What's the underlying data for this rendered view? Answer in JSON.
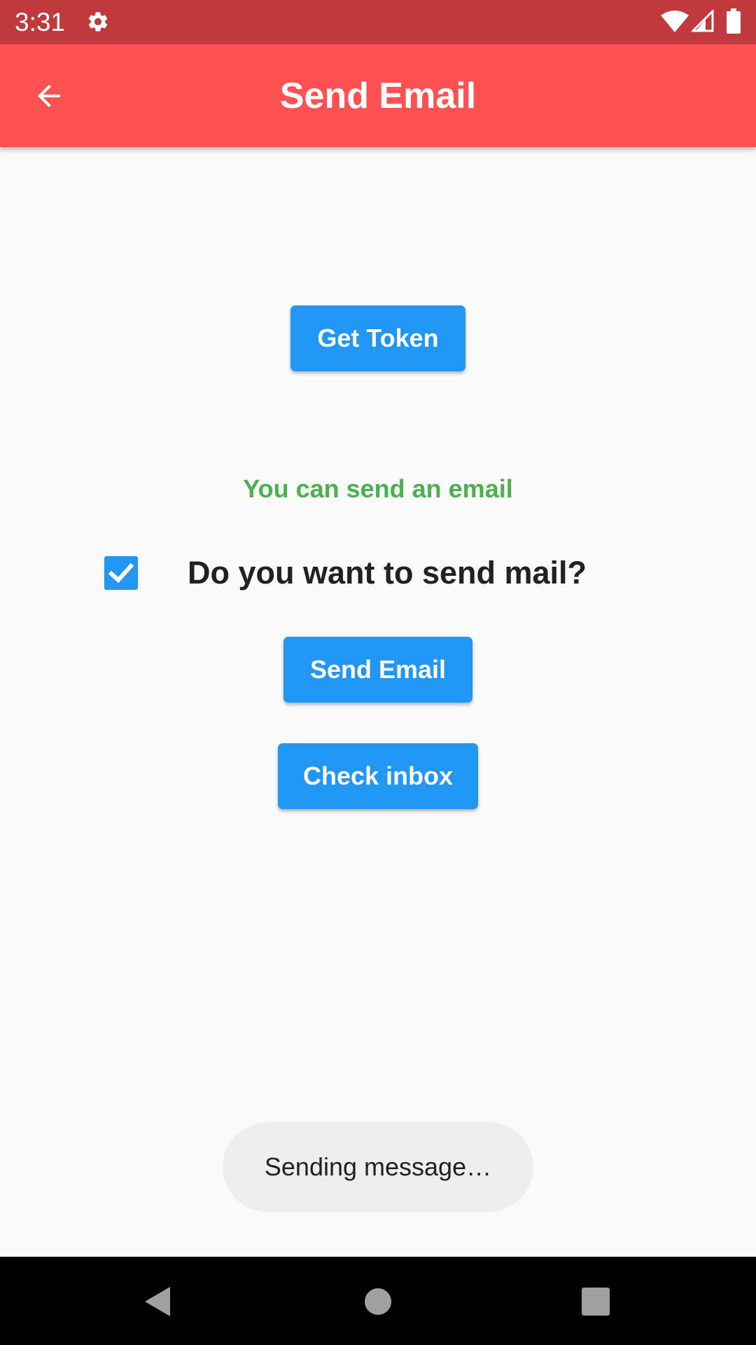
{
  "status_bar": {
    "time": "3:31",
    "icons": [
      "gear-icon",
      "wifi-icon",
      "signal-icon",
      "battery-icon"
    ]
  },
  "app_bar": {
    "title": "Send Email",
    "back_icon": "arrow-back-icon",
    "color": "#fe5252"
  },
  "main": {
    "get_token_label": "Get Token",
    "status_message": "You can send an email",
    "checkbox_checked": true,
    "checkbox_label": "Do you want to send mail?",
    "send_email_label": "Send Email",
    "check_inbox_label": "Check inbox"
  },
  "toast": {
    "text": "Sending message…"
  },
  "nav_bar": {
    "icons": [
      "back-triangle-icon",
      "home-circle-icon",
      "recents-square-icon"
    ]
  },
  "colors": {
    "accent": "#2196f3",
    "success": "#4caf50",
    "status_bar": "#c0393d"
  }
}
